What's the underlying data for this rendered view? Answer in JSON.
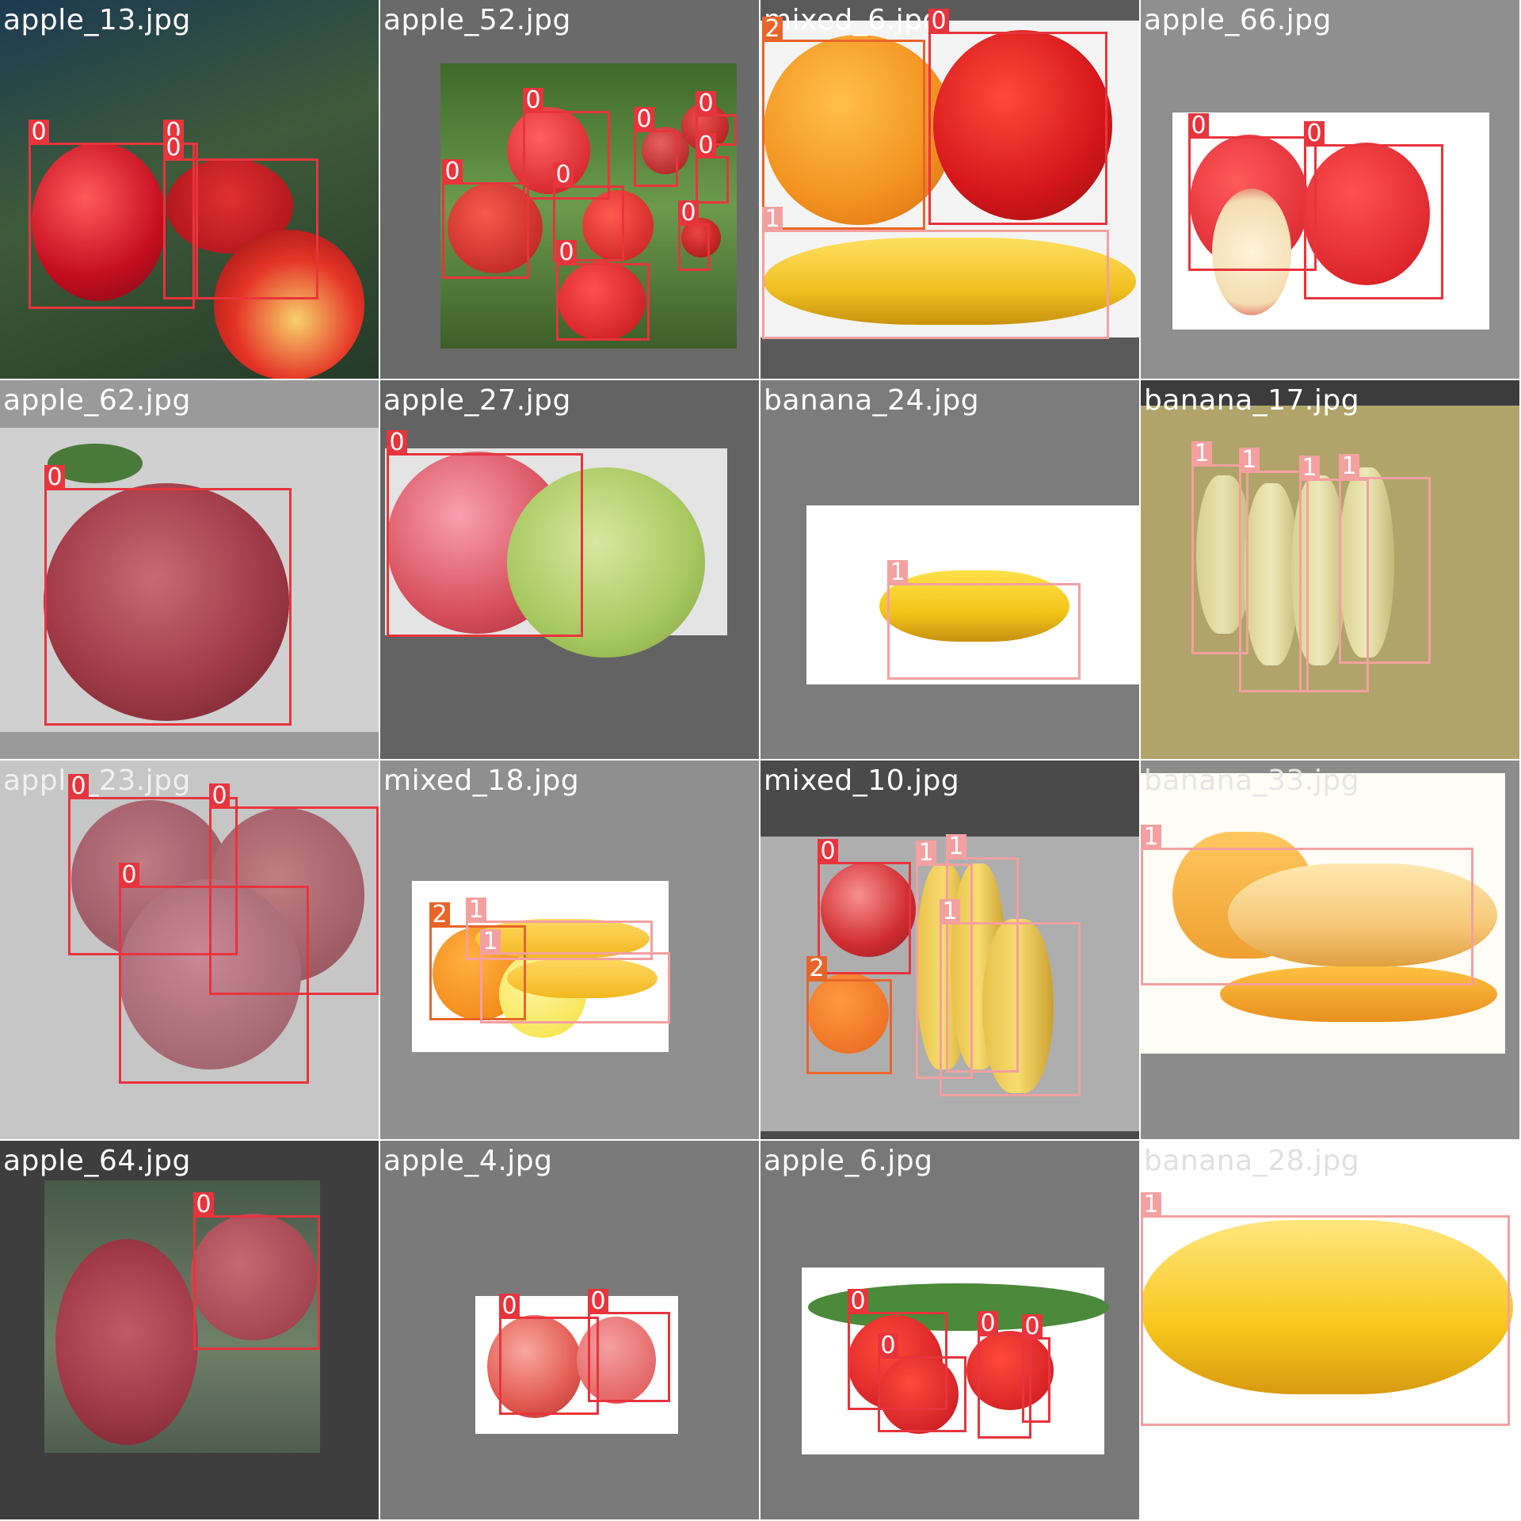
{
  "title": "",
  "class_colors": {
    "0": "#e8343c",
    "1": "#f4a0a0",
    "2": "#e8652a"
  },
  "tiles": [
    {
      "filename": "apple_13.jpg",
      "title_color": "#ffffff",
      "boxes": [
        {
          "class": "0"
        },
        {
          "class": "0"
        },
        {
          "class": "0"
        }
      ]
    },
    {
      "filename": "apple_52.jpg",
      "title_color": "#ffffff",
      "boxes": [
        {
          "class": "0"
        },
        {
          "class": "0"
        },
        {
          "class": "0"
        },
        {
          "class": "0"
        },
        {
          "class": "0"
        },
        {
          "class": "0"
        },
        {
          "class": "0"
        },
        {
          "class": "0"
        }
      ]
    },
    {
      "filename": "mixed_6.jpg",
      "title_color": "#ffffff",
      "boxes": [
        {
          "class": "2"
        },
        {
          "class": "0"
        },
        {
          "class": "1"
        }
      ]
    },
    {
      "filename": "apple_66.jpg",
      "title_color": "#ffffff",
      "boxes": [
        {
          "class": "0"
        },
        {
          "class": "0"
        }
      ]
    },
    {
      "filename": "apple_62.jpg",
      "title_color": "#ffffff",
      "boxes": [
        {
          "class": "0"
        }
      ]
    },
    {
      "filename": "apple_27.jpg",
      "title_color": "#ffffff",
      "boxes": [
        {
          "class": "0"
        }
      ]
    },
    {
      "filename": "banana_24.jpg",
      "title_color": "#ffffff",
      "boxes": [
        {
          "class": "1"
        }
      ]
    },
    {
      "filename": "banana_17.jpg",
      "title_color": "#ffffff",
      "boxes": [
        {
          "class": "1"
        },
        {
          "class": "1"
        },
        {
          "class": "1"
        },
        {
          "class": "1"
        }
      ]
    },
    {
      "filename": "apple_23.jpg",
      "title_color": "#f0f0f0",
      "boxes": [
        {
          "class": "0"
        },
        {
          "class": "0"
        },
        {
          "class": "0"
        }
      ]
    },
    {
      "filename": "mixed_18.jpg",
      "title_color": "#ffffff",
      "boxes": [
        {
          "class": "2"
        },
        {
          "class": "1"
        },
        {
          "class": "1"
        }
      ]
    },
    {
      "filename": "mixed_10.jpg",
      "title_color": "#ffffff",
      "boxes": [
        {
          "class": "0"
        },
        {
          "class": "1"
        },
        {
          "class": "1"
        },
        {
          "class": "1"
        },
        {
          "class": "2"
        }
      ]
    },
    {
      "filename": "banana_33.jpg",
      "title_color": "#e6e6e6",
      "boxes": [
        {
          "class": "1"
        }
      ]
    },
    {
      "filename": "apple_64.jpg",
      "title_color": "#ffffff",
      "boxes": [
        {
          "class": "0"
        }
      ]
    },
    {
      "filename": "apple_4.jpg",
      "title_color": "#ffffff",
      "boxes": [
        {
          "class": "0"
        },
        {
          "class": "0"
        }
      ]
    },
    {
      "filename": "apple_6.jpg",
      "title_color": "#ffffff",
      "boxes": [
        {
          "class": "0"
        },
        {
          "class": "0"
        },
        {
          "class": "0"
        },
        {
          "class": "0"
        }
      ]
    },
    {
      "filename": "banana_28.jpg",
      "title_color": "#e0e0e0",
      "boxes": [
        {
          "class": "1"
        }
      ]
    }
  ]
}
